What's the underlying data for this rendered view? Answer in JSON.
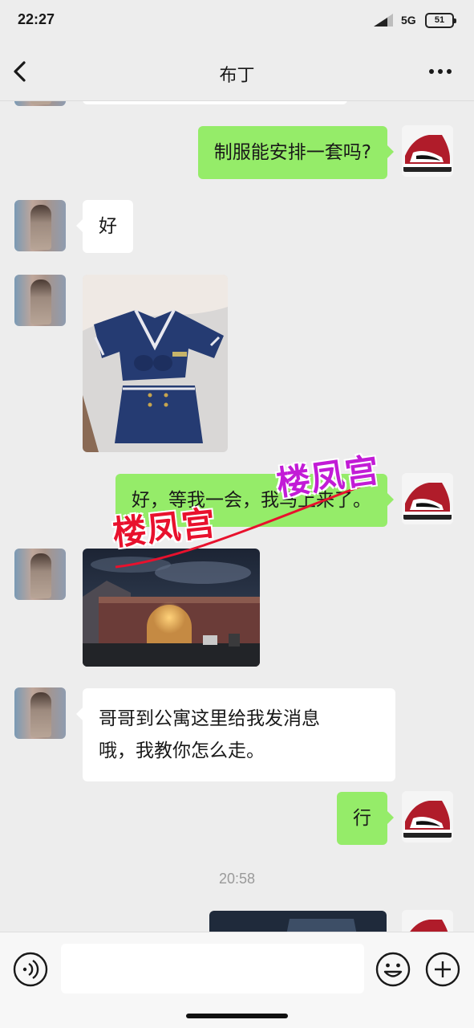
{
  "status_bar": {
    "time": "22:27",
    "network": "5G",
    "battery": "51"
  },
  "header": {
    "title": "布丁"
  },
  "messages": {
    "m1": "制服能安排一套吗?",
    "m2": "好",
    "m4": "好，等我一会，我马上来了。",
    "m6_line1": "哥哥到公寓这里给我发消息",
    "m6_line2": "哦，我教你怎么走。",
    "m7": "行"
  },
  "timestamp": "20:58",
  "watermarks": {
    "text_1": "楼凤宫",
    "text_2": "楼凤宫",
    "color_1": "#e8112d",
    "color_2": "#c21cd6"
  },
  "input": {
    "placeholder": ""
  },
  "colors": {
    "sent_bubble": "#95ec69",
    "received_bubble": "#ffffff",
    "background": "#ededed"
  },
  "icons": {
    "back": "chevron-left-icon",
    "more": "more-dots-icon",
    "voice": "voice-icon",
    "emoji": "emoji-icon",
    "plus": "plus-icon"
  }
}
